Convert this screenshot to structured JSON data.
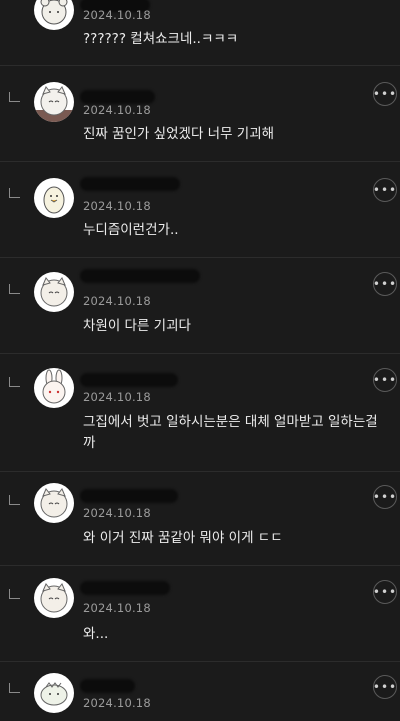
{
  "comments": [
    {
      "id": "c0",
      "date": "2024.10.18",
      "text": "?????? 컬쳐쇼크네..ㅋㅋㅋ",
      "avatar": "bear-avatar",
      "reply": false
    },
    {
      "id": "c1",
      "date": "2024.10.18",
      "text": "진짜 꿈인가 싶었겠다 너무 기괴해",
      "avatar": "cat-avatar",
      "reply": true
    },
    {
      "id": "c2",
      "date": "2024.10.18",
      "text": "누디즘이런건가..",
      "avatar": "chick-avatar",
      "reply": true
    },
    {
      "id": "c3",
      "date": "2024.10.18",
      "text": "차원이 다른 기괴다",
      "avatar": "cat-avatar",
      "reply": true
    },
    {
      "id": "c4",
      "date": "2024.10.18",
      "text": "그집에서 벗고 일하시는분은 대체 얼마받고 일하는걸까",
      "avatar": "rabbit-avatar",
      "reply": true
    },
    {
      "id": "c5",
      "date": "2024.10.18",
      "text": "와 이거 진짜 꿈같아 뭐야 이게 ㄷㄷ",
      "avatar": "cat-avatar",
      "reply": true
    },
    {
      "id": "c6",
      "date": "2024.10.18",
      "text": "와...",
      "avatar": "cat-avatar",
      "reply": true
    },
    {
      "id": "c7",
      "date": "2024.10.18",
      "text": "",
      "avatar": "dino-avatar",
      "reply": true
    }
  ],
  "more_label": "•••",
  "colors": {
    "background": "#1b1b1b",
    "divider": "#2c2c2c",
    "date": "#9b9b9b",
    "text": "#ececec"
  }
}
